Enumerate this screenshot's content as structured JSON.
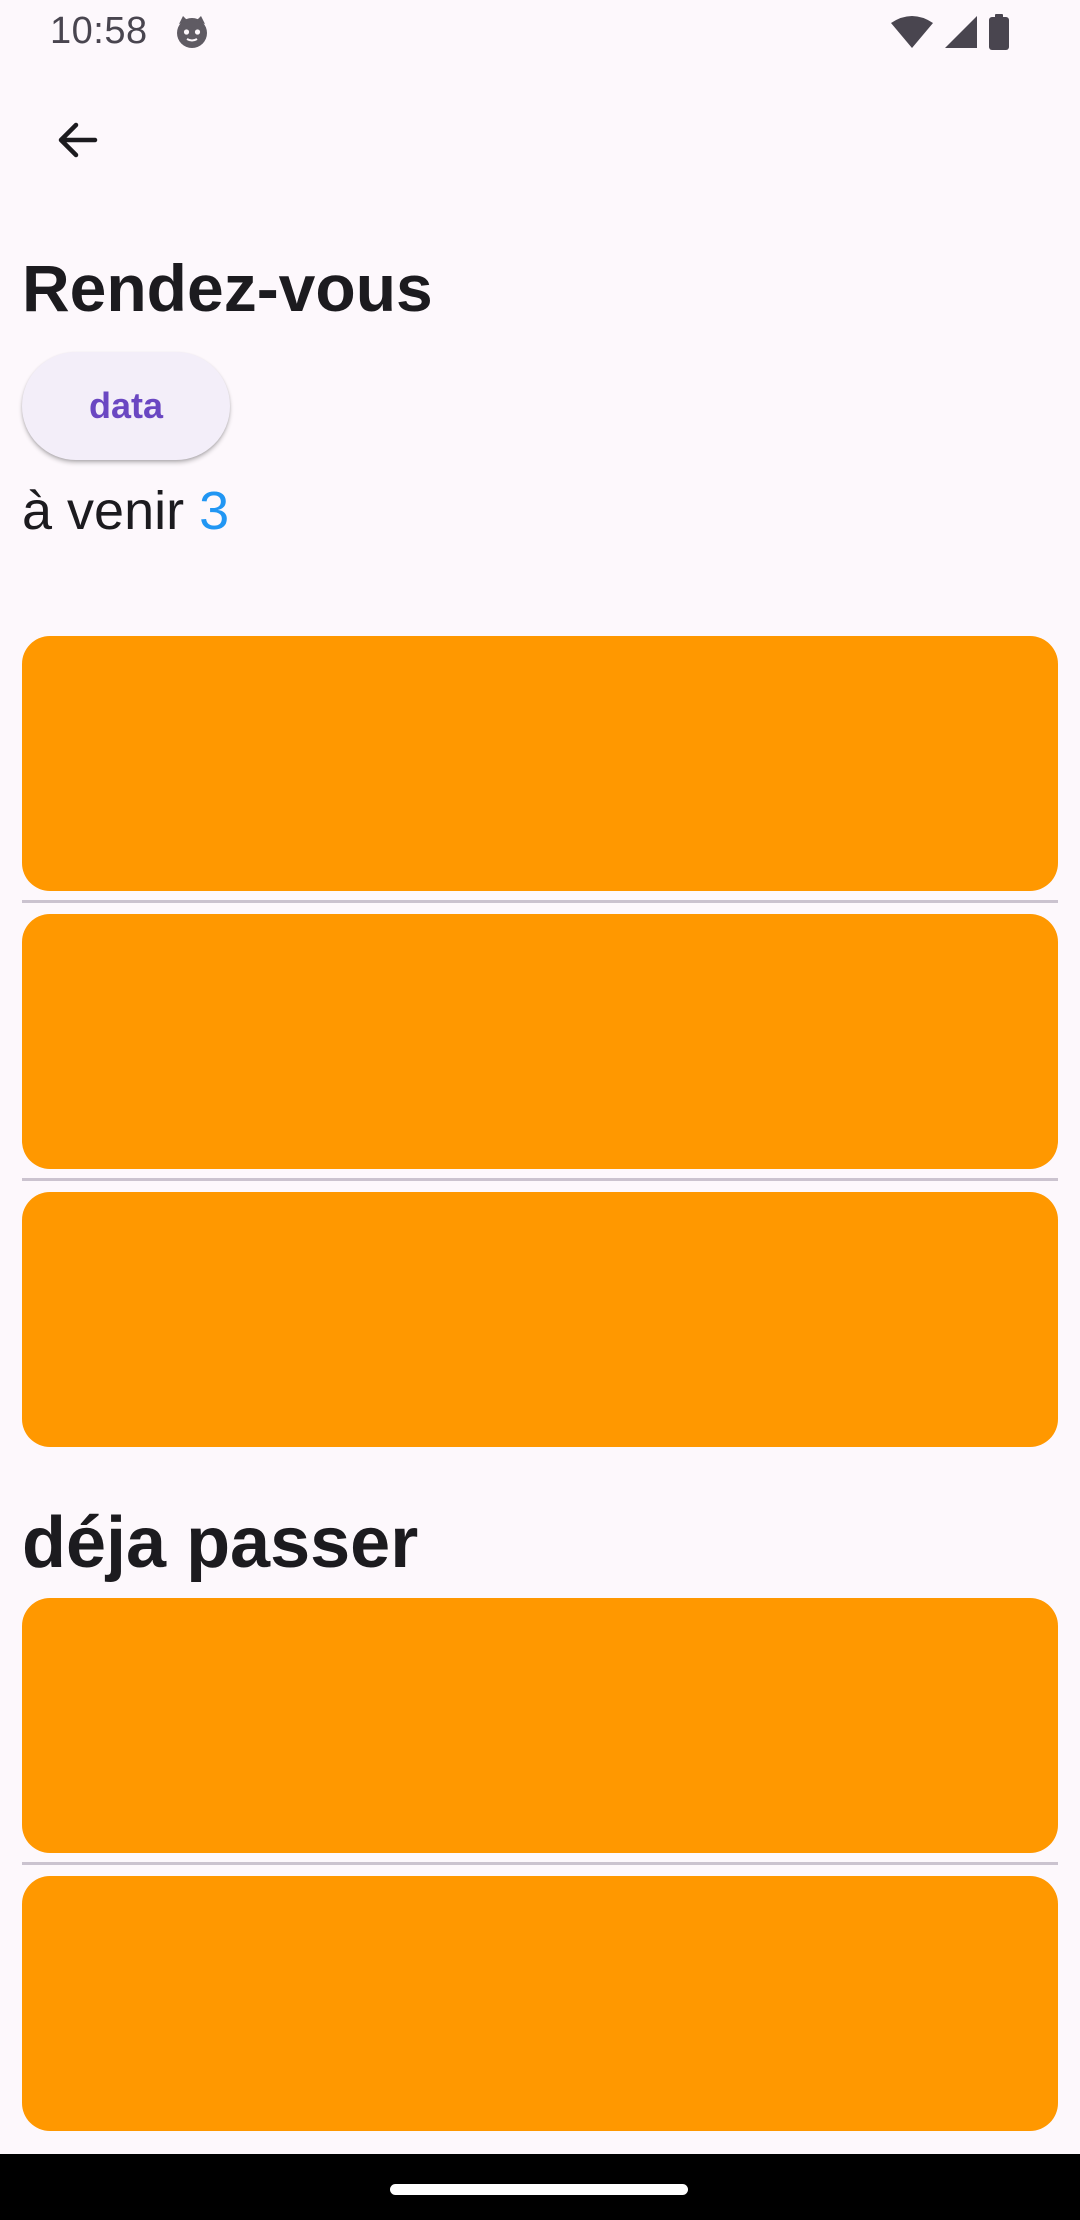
{
  "status_bar": {
    "time": "10:58",
    "app_icon": "cat-face-icon",
    "wifi_icon": "wifi-icon",
    "signal_icon": "cellular-signal-icon",
    "battery_icon": "battery-icon"
  },
  "toolbar": {
    "back_icon": "arrow-back-icon"
  },
  "header": {
    "title": "Rendez-vous"
  },
  "chip": {
    "label": "data"
  },
  "upcoming": {
    "label": "à venir",
    "count": "3",
    "count_color": "#2196f3"
  },
  "past": {
    "title": "déja passer"
  },
  "colors": {
    "card": "#ff9800",
    "background": "#fdf8fc",
    "chip_text": "#6a47c2",
    "chip_background": "#f3eef9"
  }
}
